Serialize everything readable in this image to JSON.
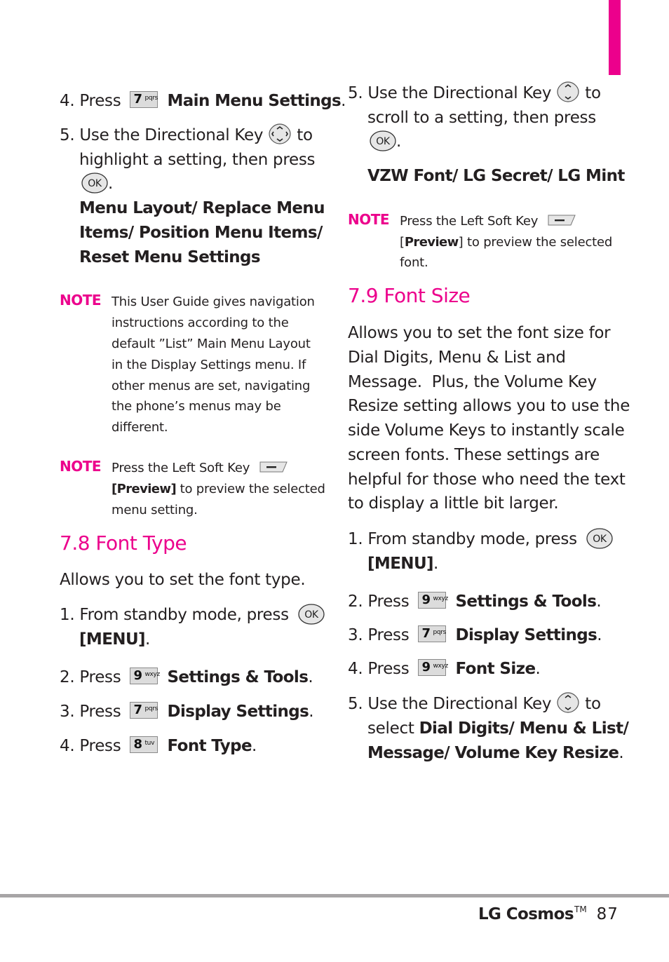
{
  "document": {
    "accent_color": "#ec008c",
    "rule_color": "#a7a5a6",
    "left_column": {
      "step4": {
        "num": "4.",
        "prefix": "Press",
        "key_num": "7",
        "key_letters": "pqrs",
        "target": "Main Menu Settings",
        "end": "."
      },
      "step5": {
        "line1_a": "5. Use the Directional Key",
        "line1_b": "to",
        "line2": "highlight a setting, then press",
        "line3_end": ".",
        "options": [
          "Menu Layout/ Replace Menu",
          "Items/ Position Menu Items/",
          "Reset Menu Settings"
        ]
      },
      "note1": {
        "label": "NOTE",
        "lines": [
          "This User Guide gives navigation",
          "instructions according to the",
          "default ”List” Main Menu Layout",
          "in the Display Settings menu. If",
          "other menus are set, navigating",
          "the phone’s menus may be",
          "different."
        ]
      },
      "note2": {
        "label": "NOTE",
        "line1": "Press the Left Soft Key",
        "line2_bold": "[Preview]",
        "line2_rest": "to preview the selected",
        "line3": "menu setting."
      },
      "section_font_type": {
        "heading": "7.8 Font Type",
        "intro": "Allows you to set the font type.",
        "step1_line1": "1. From standby mode, press",
        "step1_line2_bold": "[MENU]",
        "step1_line2_end": ".",
        "steps": [
          {
            "num": "2.",
            "prefix": "Press",
            "key_num": "9",
            "key_letters": "wxyz",
            "target": "Settings & Tools",
            "end": "."
          },
          {
            "num": "3.",
            "prefix": "Press",
            "key_num": "7",
            "key_letters": "pqrs",
            "target": "Display Settings",
            "end": "."
          },
          {
            "num": "4.",
            "prefix": "Press",
            "key_num": "8",
            "key_letters": "tuv",
            "target": "Font Type",
            "end": "."
          }
        ]
      }
    },
    "right_column": {
      "step5": {
        "line1_a": "5. Use the Directional Key",
        "line1_b": "to",
        "line2": "scroll to a setting, then press",
        "line3_end": ".",
        "options": "VZW Font/ LG Secret/ LG Mint"
      },
      "note": {
        "label": "NOTE",
        "line1": "Press the Left Soft Key",
        "line2_open": "[",
        "line2_bold": "Preview",
        "line2_close": "]",
        "line2_rest": "to preview the selected",
        "line3": "font."
      },
      "section_font_size": {
        "heading": "7.9 Font Size",
        "intro_lines": [
          "Allows you to set the font size for",
          "Dial Digits, Menu & List and",
          "Message.  Plus, the Volume Key",
          "Resize setting allows you to use the",
          "side Volume Keys to instantly scale",
          "screen fonts. These settings are",
          "helpful for those who need the text",
          "to display a little bit larger."
        ],
        "step1_line1": "1. From standby mode, press",
        "step1_line2_bold": "[MENU]",
        "step1_line2_end": ".",
        "steps": [
          {
            "num": "2.",
            "prefix": "Press",
            "key_num": "9",
            "key_letters": "wxyz",
            "target": "Settings & Tools",
            "end": "."
          },
          {
            "num": "3.",
            "prefix": "Press",
            "key_num": "7",
            "key_letters": "pqrs",
            "target": "Display Settings",
            "end": "."
          },
          {
            "num": "4.",
            "prefix": "Press",
            "key_num": "9",
            "key_letters": "wxyz",
            "target": "Font Size",
            "end": "."
          }
        ],
        "step5_line1_a": "5. Use the Directional Key",
        "step5_line1_b": "to",
        "step5_line2_plain": "select",
        "step5_line2_bold": "Dial Digits/ Menu & List/",
        "step5_line3_bold": "Message/ Volume Key Resize",
        "step5_line3_end": "."
      }
    },
    "footer": {
      "brand": "LG Cosmos",
      "trademark": "TM",
      "page_number": "87"
    },
    "icons": {
      "ok_key": "OK",
      "ok_key_name": "ok-key-icon",
      "dir_key_4way_name": "directional-key-4way-icon",
      "dir_key_updown_name": "directional-key-updown-icon",
      "soft_key_name": "left-soft-key-icon"
    }
  }
}
